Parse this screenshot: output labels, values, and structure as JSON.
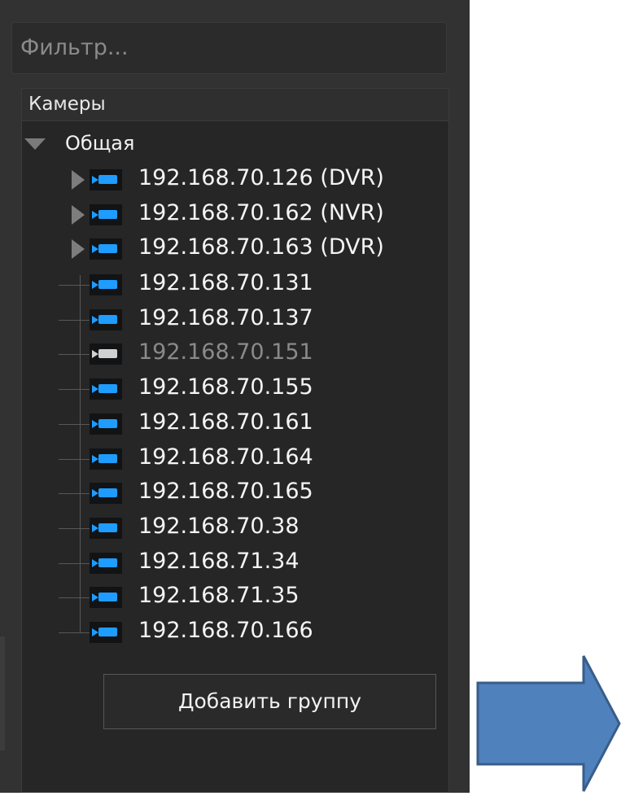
{
  "filter": {
    "placeholder": "Фильтр..."
  },
  "tree": {
    "header": "Камеры",
    "group": "Общая",
    "devices": [
      {
        "label": "192.168.70.126 (DVR)",
        "expandable": true,
        "online": true
      },
      {
        "label": "192.168.70.162 (NVR)",
        "expandable": true,
        "online": true
      },
      {
        "label": "192.168.70.163 (DVR)",
        "expandable": true,
        "online": true
      },
      {
        "label": "192.168.70.131",
        "expandable": false,
        "online": true
      },
      {
        "label": "192.168.70.137",
        "expandable": false,
        "online": true
      },
      {
        "label": "192.168.70.151",
        "expandable": false,
        "online": false
      },
      {
        "label": "192.168.70.155",
        "expandable": false,
        "online": true
      },
      {
        "label": "192.168.70.161",
        "expandable": false,
        "online": true
      },
      {
        "label": "192.168.70.164",
        "expandable": false,
        "online": true
      },
      {
        "label": "192.168.70.165",
        "expandable": false,
        "online": true
      },
      {
        "label": "192.168.70.38",
        "expandable": false,
        "online": true
      },
      {
        "label": "192.168.71.34",
        "expandable": false,
        "online": true
      },
      {
        "label": "192.168.71.35",
        "expandable": false,
        "online": true
      },
      {
        "label": "192.168.70.166",
        "expandable": false,
        "online": true
      }
    ]
  },
  "buttons": {
    "add_group": "Добавить группу"
  },
  "icons": {
    "camera": "camera-icon",
    "expand": "expand-arrow-icon",
    "annotation": "right-arrow-icon"
  },
  "colors": {
    "camera_online": "#1e9cff",
    "camera_offline": "#d0d0d0",
    "panel": "#323232",
    "annotation_arrow": "#4f81bd"
  }
}
